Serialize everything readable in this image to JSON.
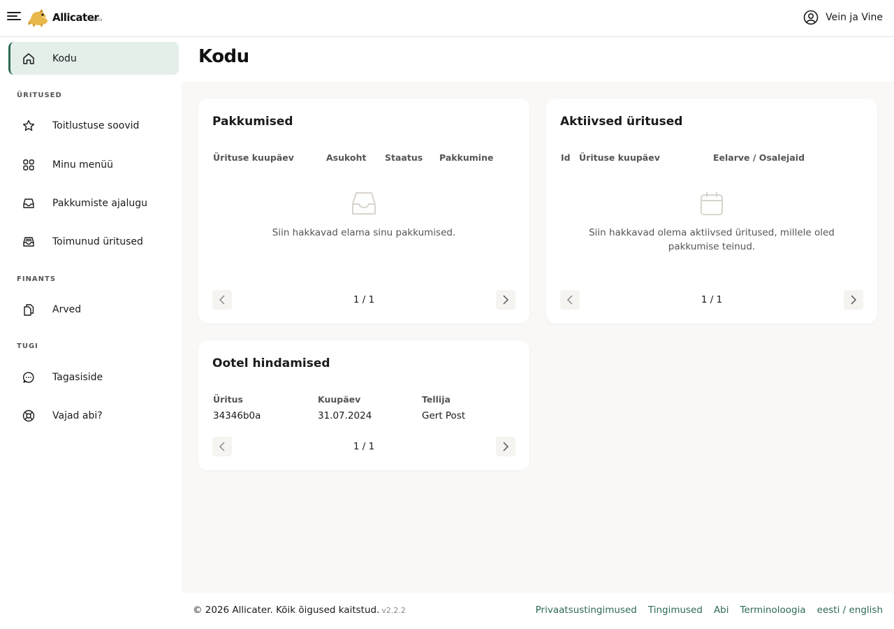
{
  "app": {
    "name": "Allicater",
    "badge": "beta"
  },
  "user": {
    "name": "Vein ja Vine"
  },
  "page": {
    "title": "Kodu"
  },
  "sidebar": {
    "home": {
      "label": "Kodu",
      "icon": "home-icon",
      "active": true
    },
    "sections": [
      {
        "label": "ÜRITUSED",
        "items": [
          {
            "label": "Toitlustuse soovid",
            "icon": "star-icon"
          },
          {
            "label": "Minu menüü",
            "icon": "grid-icon"
          },
          {
            "label": "Pakkumiste ajalugu",
            "icon": "inbox-icon"
          },
          {
            "label": "Toimunud üritused",
            "icon": "archive-inbox-icon"
          }
        ]
      },
      {
        "label": "FINANTS",
        "items": [
          {
            "label": "Arved",
            "icon": "documents-icon"
          }
        ]
      },
      {
        "label": "TUGI",
        "items": [
          {
            "label": "Tagasiside",
            "icon": "chat-bubble-icon"
          },
          {
            "label": "Vajad abi?",
            "icon": "lifebuoy-icon"
          }
        ]
      }
    ]
  },
  "cards": {
    "offers": {
      "title": "Pakkumised",
      "columns": [
        "Ürituse kuupäev",
        "Asukoht",
        "Staatus",
        "Pakkumine"
      ],
      "empty_text": "Siin hakkavad elama sinu pakkumised.",
      "pagination": "1 / 1"
    },
    "active_events": {
      "title": "Aktiivsed üritused",
      "columns": [
        "Id",
        "Ürituse kuupäev",
        "Eelarve / Osalejaid"
      ],
      "empty_text_line1": "Siin hakkavad olema aktiivsed üritused, millele oled",
      "empty_text_line2": "pakkumise teinud.",
      "pagination": "1 / 1"
    },
    "pending_reviews": {
      "title": "Ootel hindamised",
      "columns": [
        "Üritus",
        "Kuupäev",
        "Tellija"
      ],
      "rows": [
        {
          "event": "34346b0a",
          "date": "31.07.2024",
          "customer": "Gert Post"
        }
      ],
      "pagination": "1 / 1"
    }
  },
  "footer": {
    "copyright": "© 2026 Allicater. Kõik õigused kaitstud.",
    "version": "v2.2.2",
    "links": [
      "Privaatsustingimused",
      "Tingimused",
      "Abi",
      "Terminoloogia",
      "eesti / english"
    ]
  },
  "colors": {
    "accent": "#2d6a54",
    "active_bg": "#e4efea",
    "page_bg": "#f9f8f6"
  }
}
